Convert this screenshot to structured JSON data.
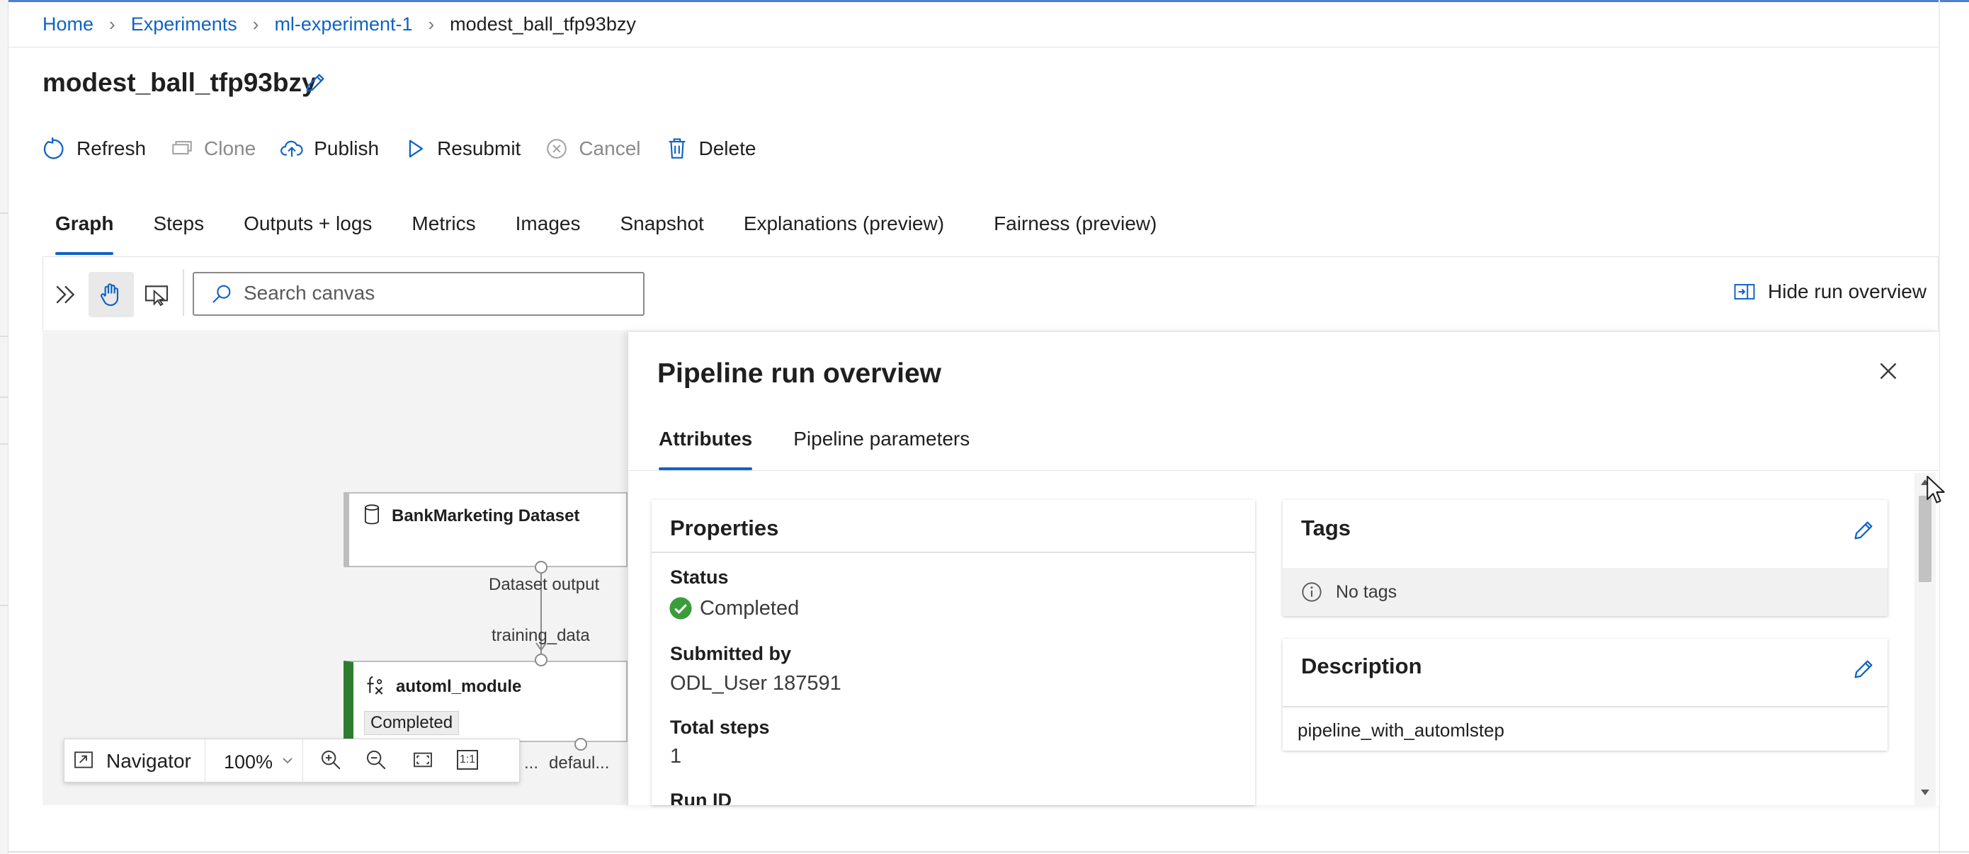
{
  "breadcrumb": {
    "items": [
      "Home",
      "Experiments",
      "ml-experiment-1",
      "modest_ball_tfp93bzy"
    ]
  },
  "page": {
    "title": "modest_ball_tfp93bzy"
  },
  "toolbar": {
    "refresh": "Refresh",
    "clone": "Clone",
    "publish": "Publish",
    "resubmit": "Resubmit",
    "cancel": "Cancel",
    "delete": "Delete"
  },
  "tabs": [
    "Graph",
    "Steps",
    "Outputs + logs",
    "Metrics",
    "Images",
    "Snapshot",
    "Explanations (preview)",
    "Fairness (preview)"
  ],
  "canvas": {
    "search_placeholder": "Search canvas",
    "hide_overview": "Hide run overview",
    "dataset_node": {
      "title": "BankMarketing Dataset",
      "output_port": "Dataset output"
    },
    "automl_node": {
      "title": "automl_module",
      "input_port": "training_data",
      "status": "Completed",
      "port_left": "...",
      "port_default": "defaul..."
    },
    "navigator": {
      "label": "Navigator",
      "zoom": "100%",
      "fit_one": "1:1"
    }
  },
  "overview": {
    "title": "Pipeline run overview",
    "tabs": [
      "Attributes",
      "Pipeline parameters"
    ],
    "properties": {
      "header": "Properties",
      "status_label": "Status",
      "status_value": "Completed",
      "submitted_label": "Submitted by",
      "submitted_value": "ODL_User 187591",
      "steps_label": "Total steps",
      "steps_value": "1",
      "runid_label": "Run ID"
    },
    "tags": {
      "header": "Tags",
      "empty": "No tags"
    },
    "description": {
      "header": "Description",
      "value": "pipeline_with_automlstep"
    }
  },
  "colors": {
    "accent": "#0f63c5",
    "success": "#3a9d3a",
    "node_stripe": "#2e7d2e"
  }
}
